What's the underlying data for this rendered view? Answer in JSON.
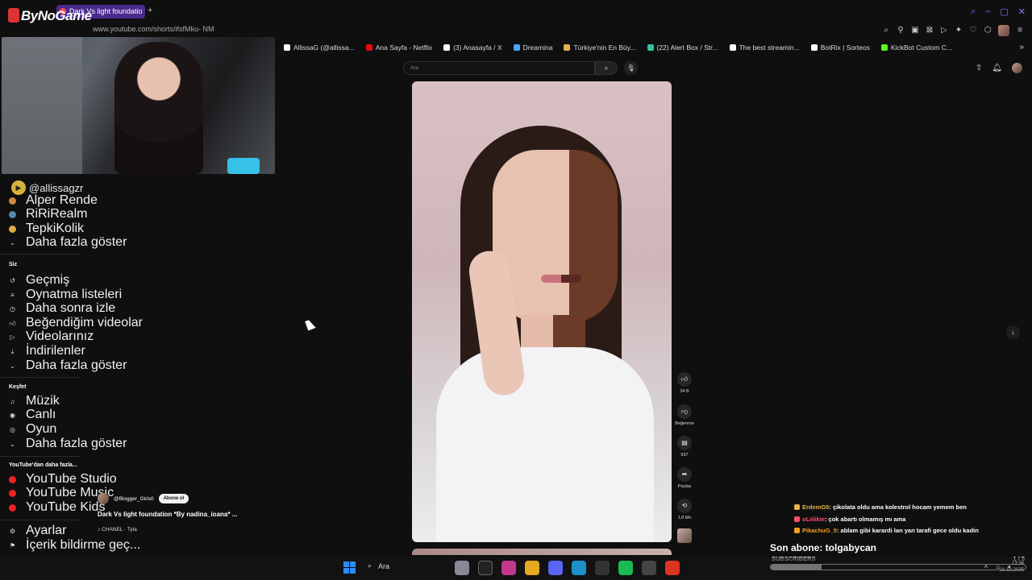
{
  "browser": {
    "tab_title": "Dark Vs light foundatio",
    "new_tab": "+",
    "url": "www.youtube.com/shorts/ifsfMku-  NM",
    "bookmarks": [
      {
        "label": "AllissaG (@allissa...",
        "color": "#ffffff"
      },
      {
        "label": "Ana Sayfa - Netflix",
        "color": "#e50914"
      },
      {
        "label": "(3) Anasayfa / X",
        "color": "#ffffff"
      },
      {
        "label": "Dreamina",
        "color": "#4aa3ff"
      },
      {
        "label": "Türkiye'nin En Büy...",
        "color": "#e8b04a"
      },
      {
        "label": "(22) Alert Box / Str...",
        "color": "#31c3a2"
      },
      {
        "label": "The best streamin...",
        "color": "#ffffff"
      },
      {
        "label": "BotRix | Sorteos",
        "color": "#ffffff"
      },
      {
        "label": "KickBot Custom C...",
        "color": "#53fc18"
      }
    ]
  },
  "overlay": {
    "logo": "ByNoGame",
    "handle": "@allissagzr"
  },
  "sidebar": {
    "subscriptions": [
      {
        "label": "Alper Rende",
        "color": "#c84"
      },
      {
        "label": "RiRiRealm",
        "color": "#58a"
      },
      {
        "label": "TepkiKolik",
        "color": "#da4"
      }
    ],
    "show_more": "Daha fazla göster",
    "you_heading": "Siz",
    "you_items": [
      "Geçmiş",
      "Oynatma listeleri",
      "Daha sonra izle",
      "Beğendiğim videolar",
      "Videolarınız",
      "İndirilenler",
      "Daha fazla göster"
    ],
    "explore_heading": "Keşfet",
    "explore_items": [
      "Müzik",
      "Canlı",
      "Oyun",
      "Daha fazla göster"
    ],
    "more_heading": "YouTube'dan daha fazla...",
    "more_items": [
      "YouTube Studio",
      "YouTube Music",
      "YouTube Kids"
    ],
    "settings": "Ayarlar",
    "report": "İçerik bildirme geç..."
  },
  "search": {
    "placeholder": "Ara"
  },
  "short": {
    "channel": "@Blogger_Girls0",
    "subscribe": "Abone ol",
    "title": "Dark Vs light foundation *By nadina_ioana* ...",
    "music": "♪ CHANEL · Tyla",
    "likes": "34 B",
    "dislike": "Beğenme",
    "comments": "937",
    "share": "Paylaş",
    "remix": "1,8 Mn"
  },
  "chat": [
    {
      "user": "ErdemG5",
      "user_color": "#e8b04a",
      "msg": ": çikolata oldu ama kolestrol hocam yemem ben"
    },
    {
      "user": "oLiilikie",
      "user_color": "#ff4d6d",
      "msg": ": çok abartı olmamış mı ama"
    },
    {
      "user": "PikachuG_0",
      "user_color": "#f0a020",
      "msg": ": ablam gibi karardi lan yan tarafi gece oldu kadin"
    }
  ],
  "subs": {
    "last_sub": "Son abone: tolgabycan",
    "label": "SUBSCRIBERS",
    "count": "1 / 5",
    "progress": 0.2
  },
  "taskbar": {
    "search": "Ara",
    "time": "13:36",
    "date": "21.12.2025"
  }
}
